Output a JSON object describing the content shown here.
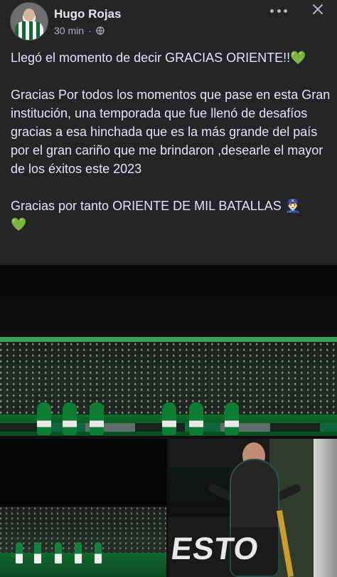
{
  "post": {
    "author_name": "Hugo Rojas",
    "time_ago": "30 min",
    "separator": "·",
    "privacy_icon": "globe-icon",
    "more_icon": "more-horizontal-icon",
    "close_icon": "close-icon",
    "lines": {
      "line1": "Llegó el momento de decir GRACIAS ORIENTE!!💚",
      "line2": "Gracias Por todos los momentos que pase en esta Gran institución, una temporada que fue llenó de desafíos gracias a esa hinchada que es la más grande del país por el gran cariño que me brindaron ,desearle el mayor de los éxitos este 2023",
      "line3": "Gracias por tanto ORIENTE DE MIL BATALLAS 👮🏻",
      "line4": "💚"
    }
  },
  "photos": {
    "right_overlay_text": "ESTO"
  },
  "colors": {
    "background": "#242526",
    "text_primary": "#e4e6eb",
    "text_secondary": "#b0b3b8",
    "oriente_green": "#0d7d34"
  }
}
